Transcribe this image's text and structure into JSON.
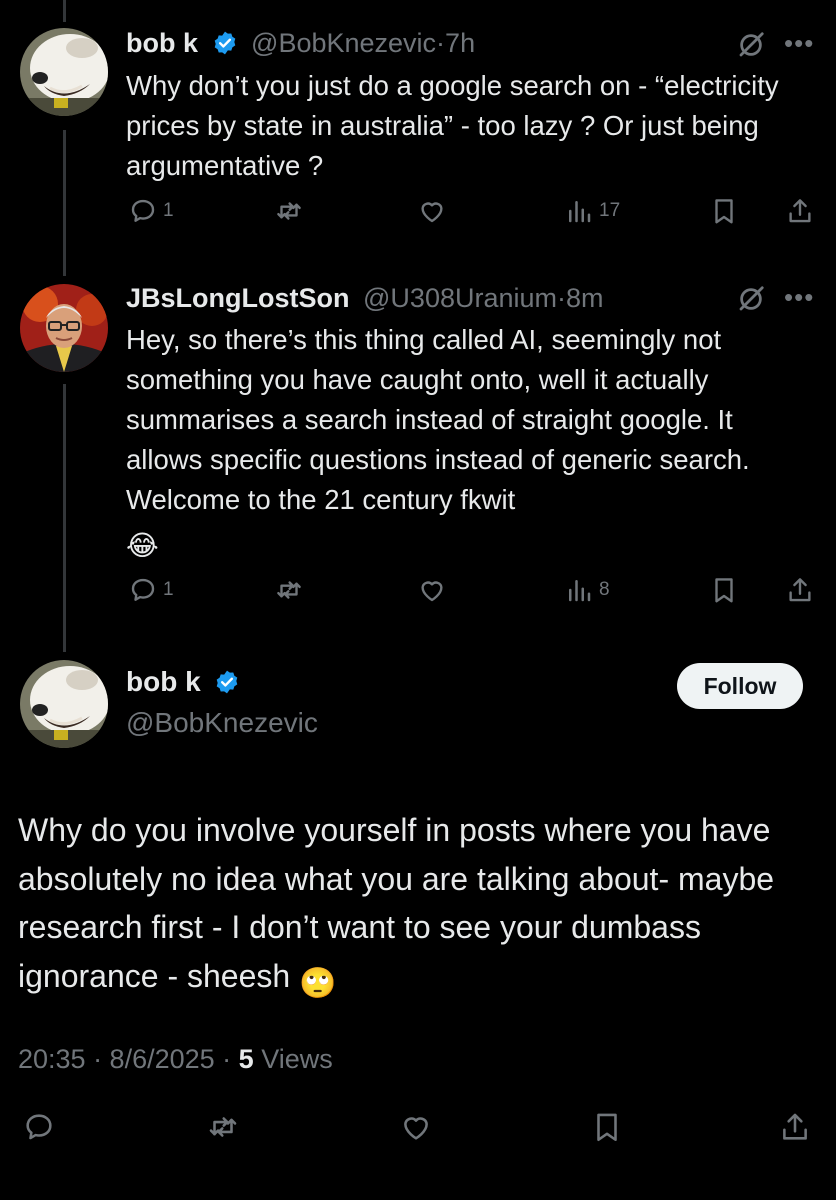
{
  "tweets": [
    {
      "name": "bob k",
      "handle": "@BobKnezevic",
      "separator": "·",
      "time": "7h",
      "text": "Why don’t you just do a google search on - “electricity prices by state in australia” - too lazy ? Or just being argumentative ?",
      "replies": "1",
      "views": "17",
      "avatar_icon": "dog-photo-avatar"
    },
    {
      "name": "JBsLongLostSon",
      "handle": "@U308Uranium",
      "separator": "·",
      "time": "8m",
      "text": "Hey, so there’s this thing called AI, seemingly not something you have caught onto, well it actually summarises a search instead of straight google. It allows specific questions instead of generic search. Welcome to the 21 century fkwit",
      "emoji": "😂",
      "replies": "1",
      "views": "8",
      "avatar_icon": "man-portrait-avatar"
    }
  ],
  "main_tweet": {
    "name": "bob k",
    "handle": "@BobKnezevic",
    "follow_label": "Follow",
    "text": "Why do you involve yourself in posts where you have absolutely no idea what you are talking about- maybe research first - I don’t want to see your dumbass ignorance - sheesh",
    "emoji": "🙄",
    "timestamp": "20:35 · 8/6/2025 · ",
    "views_count": "5",
    "views_label": " Views"
  },
  "icons": {
    "verified_color": "#1d9bf0",
    "muted_color": "#71767b"
  }
}
